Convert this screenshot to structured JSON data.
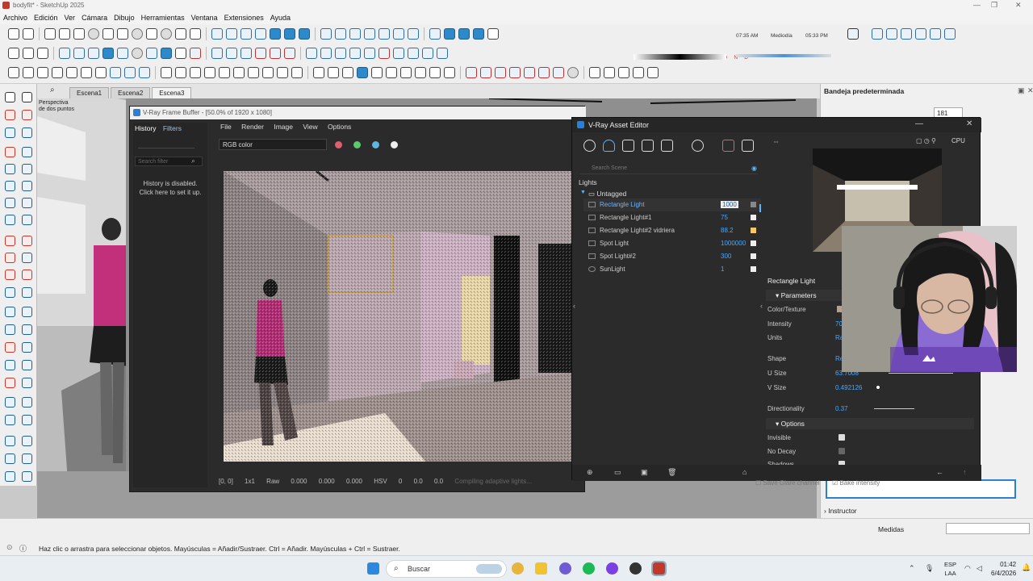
{
  "window": {
    "title": "bodyfit* - SketchUp 2025"
  },
  "menu": [
    "Archivo",
    "Edición",
    "Ver",
    "Cámara",
    "Dibujo",
    "Herramientas",
    "Ventana",
    "Extensiones",
    "Ayuda"
  ],
  "shadow": {
    "months": "E F M A M J J A S O N D",
    "time_start": "07:35 AM",
    "time_mid": "Mediodía",
    "time_end": "05:33 PM"
  },
  "scenes": [
    "Escena1",
    "Escena2",
    "Escena3"
  ],
  "viewport": {
    "label": "Perspectiva\nde dos puntos"
  },
  "vfb": {
    "title": "V-Ray Frame Buffer - [50.0% of 1920 x 1080]",
    "tabs": [
      "History",
      "Filters"
    ],
    "history_search": "Search filter",
    "history_msg": "History is disabled.\nClick here to set it up.",
    "menu": [
      "File",
      "Render",
      "Image",
      "View",
      "Options"
    ],
    "channel": "RGB color",
    "status": {
      "coords": "[0, 0]",
      "ratio": "1x1",
      "raw": "Raw",
      "v1": "0.000",
      "v2": "0.000",
      "v3": "0.000",
      "mode": "HSV",
      "h": "0",
      "s": "0.0",
      "v": "0.0",
      "progress": "Compiling adaptive lights..."
    }
  },
  "asset_editor": {
    "title": "V-Ray Asset Editor",
    "search_placeholder": "Search Scene",
    "category": "Lights",
    "group": "Untagged",
    "lights": [
      {
        "name": "Rectangle Light",
        "value": "1000"
      },
      {
        "name": "Rectangle Light#1",
        "value": "75"
      },
      {
        "name": "Rectangle Light#2 vidriera",
        "value": "88.2"
      },
      {
        "name": "Spot Light",
        "value": "1000000"
      },
      {
        "name": "Spot Light#2",
        "value": "300"
      },
      {
        "name": "SunLight",
        "value": "1"
      }
    ],
    "render_mode": "CPU",
    "panel_title": "Rectangle Light",
    "parameters_label": "Parameters",
    "color_texture": "Color/Texture",
    "intensity": {
      "label": "Intensity",
      "value": "70"
    },
    "units": {
      "label": "Units",
      "value": "Ra"
    },
    "shape": {
      "label": "Shape",
      "value": "Re"
    },
    "u_size": {
      "label": "U Size",
      "value": "63.7008"
    },
    "v_size": {
      "label": "V Size",
      "value": "0.492126"
    },
    "directionality": {
      "label": "Directionality",
      "value": "0.37"
    },
    "options_label": "Options",
    "invisible": "Invisible",
    "no_decay": "No Decay",
    "shadows": "Shadows",
    "save_glare": "Save Glare channel",
    "bake_intensity": "Bake intensity"
  },
  "tray": {
    "title": "Bandeja predeterminada",
    "value": "181",
    "instructor": "Instructor"
  },
  "status": {
    "message": "Haz clic o arrastra para seleccionar objetos. Mayúsculas = Añadir/Sustraer. Ctrl = Añadir. Mayúsculas + Ctrl = Sustraer.",
    "measurements_label": "Medidas"
  },
  "taskbar": {
    "search": "Buscar",
    "lang1": "ESP",
    "lang2": "LAA",
    "time": "01:42",
    "date": "6/4/2026"
  }
}
